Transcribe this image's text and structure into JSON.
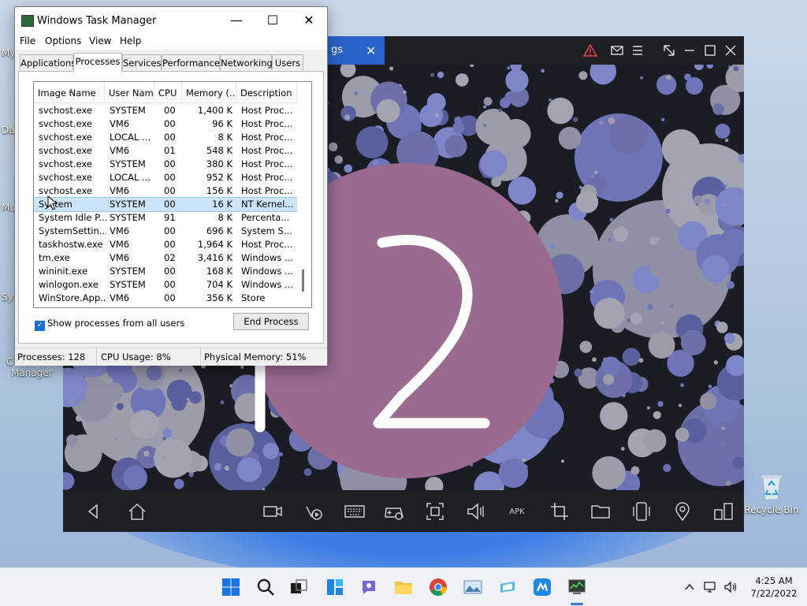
{
  "desktop": {
    "left_labels": [
      "My",
      "Da",
      "Mu",
      "Sys",
      "C"
    ],
    "manager_label": "Manager",
    "recycle_bin_label": "Recycle Bin",
    "wallpaper_colors": [
      "#1e5fd6",
      "#2c74e8"
    ]
  },
  "emulator": {
    "tab_label": "gs",
    "screen_text": "12",
    "accent_color": "#9a6a8f",
    "title_icons": [
      "warning-icon",
      "mail-icon",
      "menu-icon",
      "resize-icon",
      "minimize-icon",
      "maximize-icon",
      "close-icon"
    ],
    "nav_icons": [
      "back-icon",
      "home-icon",
      "camera-icon",
      "location-record-icon",
      "keyboard-icon",
      "gamepad-icon",
      "screenshot-icon",
      "volume-icon",
      "apk-icon",
      "crop-icon",
      "folder-icon",
      "rotate-icon",
      "location-icon",
      "multi-window-icon"
    ],
    "apk_label": "APK"
  },
  "task_manager": {
    "title": "Windows Task Manager",
    "menu": [
      "File",
      "Options",
      "View",
      "Help"
    ],
    "tabs": [
      "Applications",
      "Processes",
      "Services",
      "Performance",
      "Networking",
      "Users"
    ],
    "active_tab": "Processes",
    "columns": [
      "Image Name",
      "User Name",
      "CPU",
      "Memory (...",
      "Description"
    ],
    "rows": [
      [
        "svchost.exe",
        "SYSTEM",
        "00",
        "1,400 K",
        "Host Proc..."
      ],
      [
        "svchost.exe",
        "VM6",
        "00",
        "96 K",
        "Host Proc..."
      ],
      [
        "svchost.exe",
        "LOCAL ...",
        "00",
        "8 K",
        "Host Proc..."
      ],
      [
        "svchost.exe",
        "VM6",
        "01",
        "548 K",
        "Host Proc..."
      ],
      [
        "svchost.exe",
        "SYSTEM",
        "00",
        "380 K",
        "Host Proc..."
      ],
      [
        "svchost.exe",
        "LOCAL ...",
        "00",
        "952 K",
        "Host Proc..."
      ],
      [
        "svchost.exe",
        "VM6",
        "00",
        "156 K",
        "Host Proc..."
      ],
      [
        "System",
        "SYSTEM",
        "00",
        "16 K",
        "NT Kernel..."
      ],
      [
        "System Idle P...",
        "SYSTEM",
        "91",
        "8 K",
        "Percenta..."
      ],
      [
        "SystemSettin...",
        "VM6",
        "00",
        "696 K",
        "System S..."
      ],
      [
        "taskhostw.exe",
        "VM6",
        "00",
        "1,964 K",
        "Host Proc..."
      ],
      [
        "tm.exe",
        "VM6",
        "02",
        "3,416 K",
        "Windows ..."
      ],
      [
        "wininit.exe",
        "SYSTEM",
        "00",
        "168 K",
        "Windows ..."
      ],
      [
        "winlogon.exe",
        "SYSTEM",
        "00",
        "704 K",
        "Windows ..."
      ],
      [
        "WinStore.App...",
        "VM6",
        "00",
        "356 K",
        "Store"
      ]
    ],
    "selected_row": 7,
    "show_all_label": "Show processes from all users",
    "show_all_checked": true,
    "end_process_label": "End Process",
    "status": {
      "processes": "Processes: 128",
      "cpu": "CPU Usage: 8%",
      "memory": "Physical Memory: 51%"
    }
  },
  "taskbar": {
    "icons": [
      "windows-start-icon",
      "search-icon",
      "task-view-icon",
      "widgets-icon",
      "chat-icon",
      "file-explorer-icon",
      "chrome-icon",
      "photos-icon",
      "app-icon",
      "emulator-icon",
      "task-manager-icon"
    ],
    "time": "4:25 AM",
    "date": "7/22/2022",
    "tray_icons": [
      "chevron-up-icon",
      "network-icon",
      "volume-icon"
    ]
  }
}
